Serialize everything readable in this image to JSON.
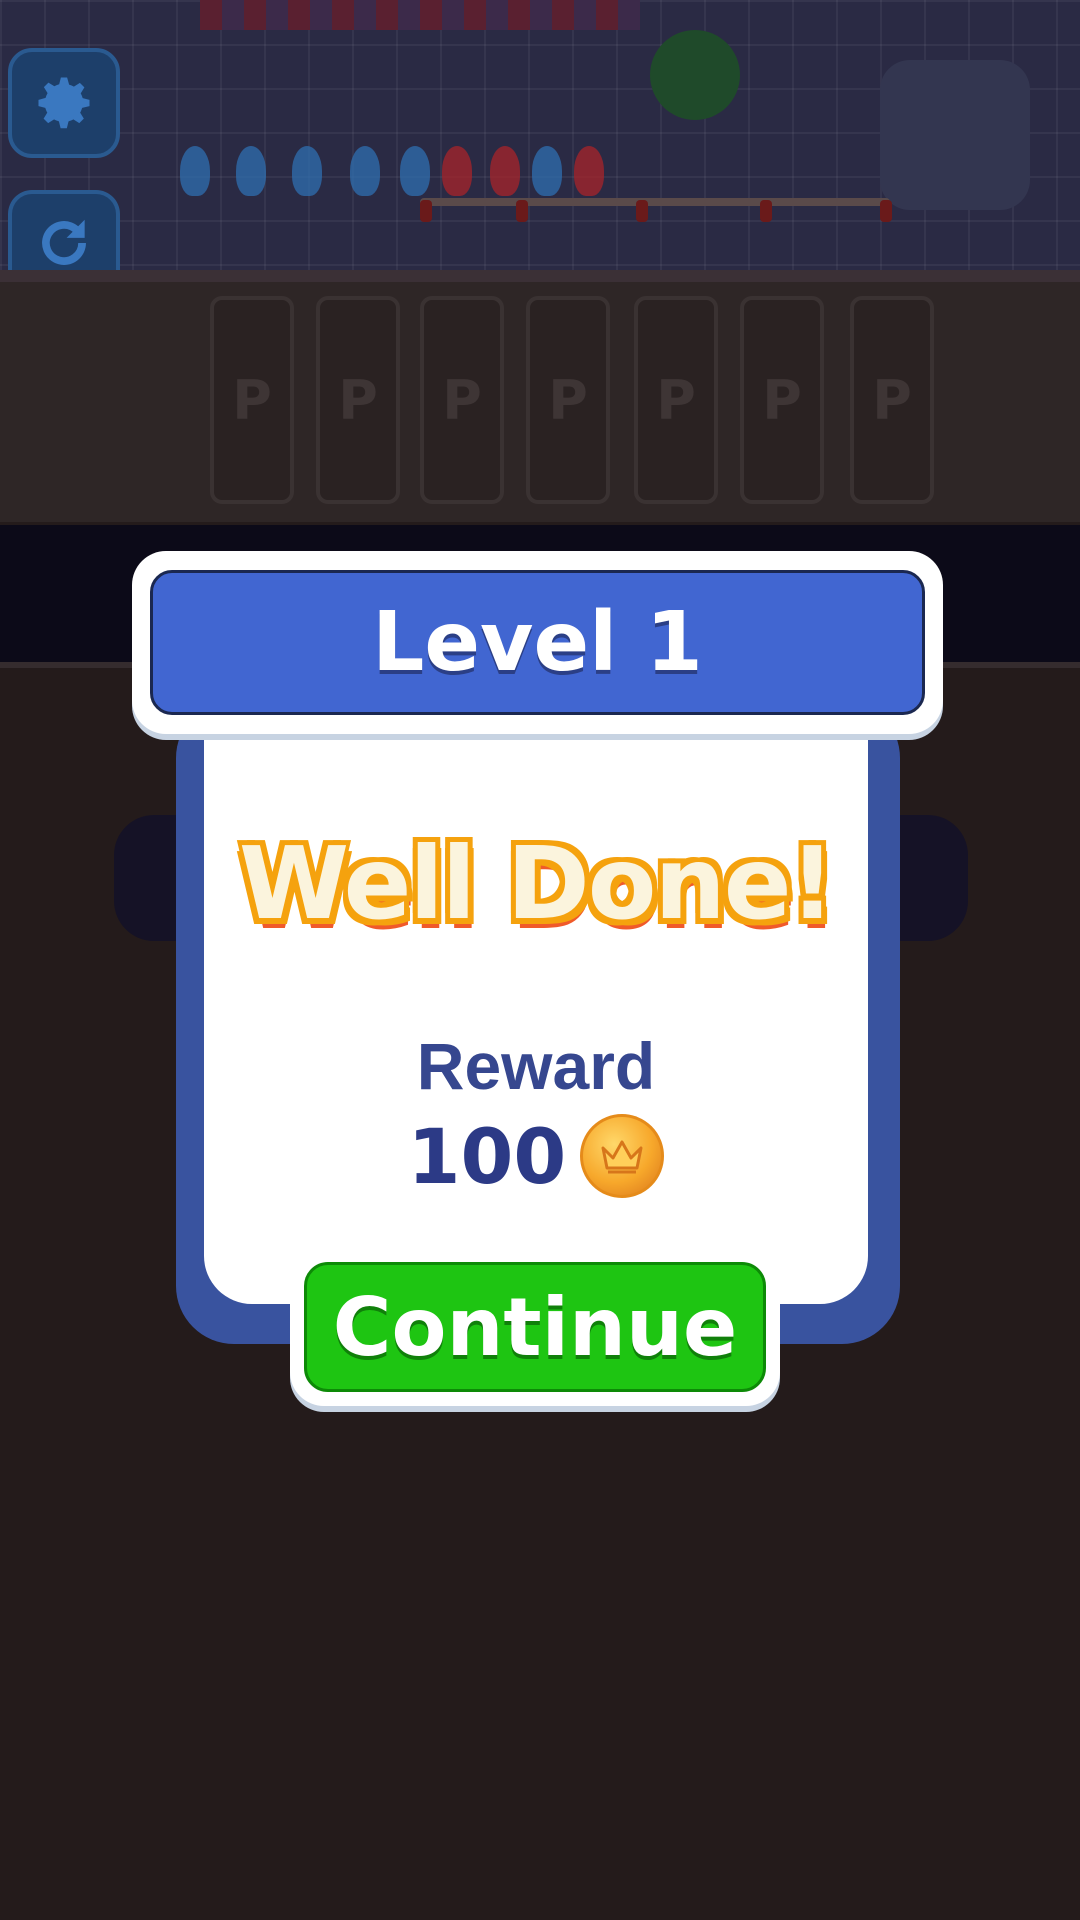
{
  "scene": {
    "slot_letters": [
      "P",
      "P",
      "P",
      "P",
      "P",
      "P",
      "P"
    ],
    "nozzle_colors": [
      "#2f6fb0",
      "#2f6fb0",
      "#2f6fb0",
      "#2f6fb0",
      "#2f6fb0",
      "#a8242a",
      "#a8242a",
      "#2f6fb0",
      "#a8242a"
    ]
  },
  "dialog": {
    "title": "Level 1",
    "headline": "Well Done!",
    "reward_label": "Reward",
    "reward_amount": "100",
    "reward_icon": "crown-coin-icon",
    "continue_label": "Continue"
  },
  "colors": {
    "title_bar": "#4166d1",
    "dialog_frame": "#39539f",
    "continue_button": "#1ec512",
    "headline_outline": "#f5a20e"
  }
}
